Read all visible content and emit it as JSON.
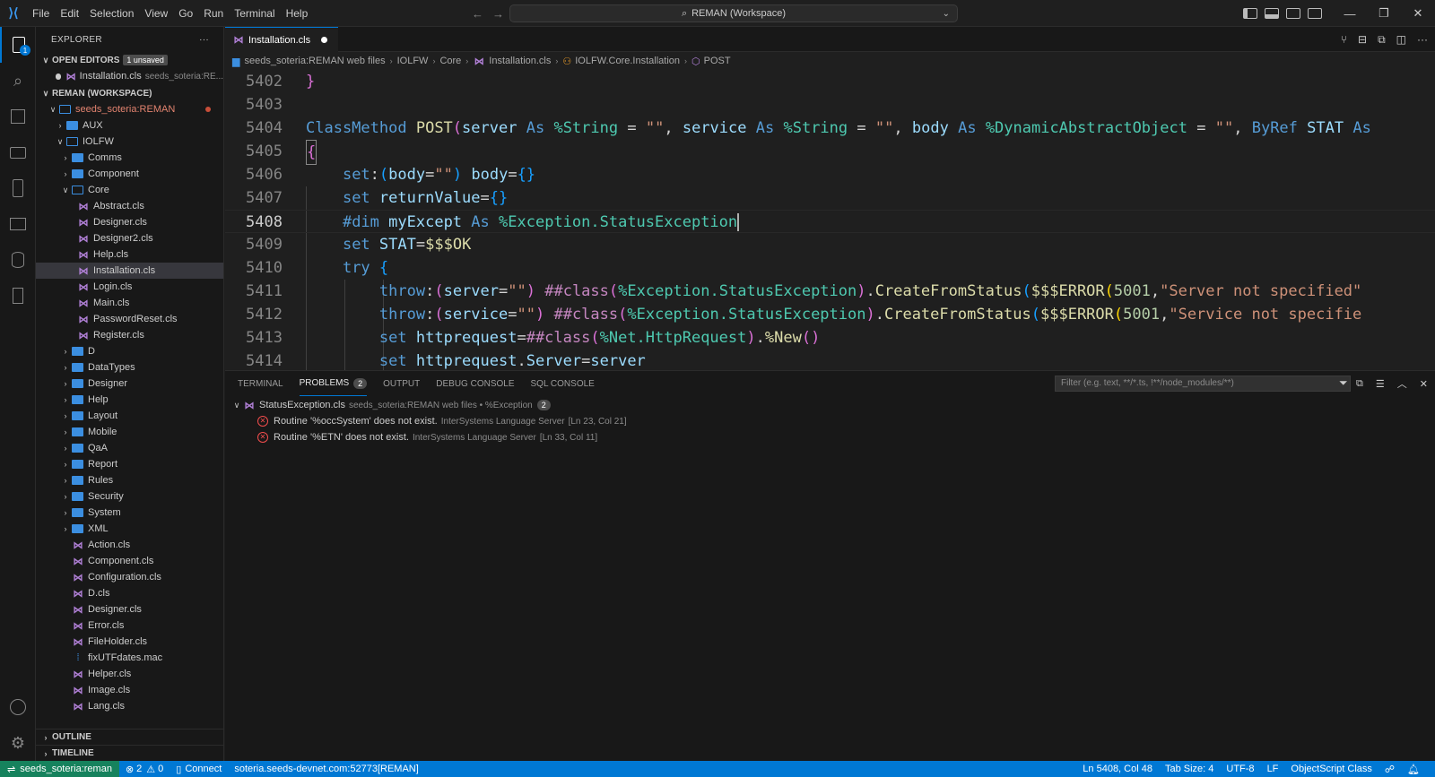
{
  "titlebar": {
    "menu": [
      "File",
      "Edit",
      "Selection",
      "View",
      "Go",
      "Run",
      "Terminal",
      "Help"
    ],
    "command_center": "REMAN (Workspace)"
  },
  "activity": {
    "explorer_badge": "1"
  },
  "sidebar": {
    "title": "EXPLORER",
    "more": "···",
    "open_editors": {
      "label": "OPEN EDITORS",
      "badge": "1 unsaved",
      "items": [
        {
          "name": "Installation.cls",
          "path": "seeds_soteria:RE..."
        }
      ]
    },
    "workspace": {
      "label": "REMAN (WORKSPACE)",
      "root": "seeds_soteria:REMAN",
      "aux": "AUX",
      "iolfw": "IOLFW",
      "iolfw_folders_before": [
        "Comms",
        "Component"
      ],
      "core": "Core",
      "core_files": [
        "Abstract.cls",
        "Designer.cls",
        "Designer2.cls",
        "Help.cls",
        "Installation.cls",
        "Login.cls",
        "Main.cls",
        "PasswordReset.cls",
        "Register.cls"
      ],
      "iolfw_folders_after": [
        "D",
        "DataTypes",
        "Designer",
        "Help",
        "Layout",
        "Mobile",
        "QaA",
        "Report",
        "Rules",
        "Security",
        "System",
        "XML"
      ],
      "iolfw_files": [
        "Action.cls",
        "Component.cls",
        "Configuration.cls",
        "D.cls",
        "Designer.cls",
        "Error.cls",
        "FileHolder.cls",
        "fixUTFdates.mac",
        "Helper.cls",
        "Image.cls",
        "Lang.cls"
      ]
    },
    "outline": "OUTLINE",
    "timeline": "TIMELINE"
  },
  "editor": {
    "tab": "Installation.cls",
    "breadcrumb": [
      "seeds_soteria:REMAN web files",
      "IOLFW",
      "Core",
      "Installation.cls",
      "IOLFW.Core.Installation",
      "POST"
    ],
    "lines": [
      {
        "num": "5402",
        "text": "}"
      },
      {
        "num": "5403",
        "text": ""
      },
      {
        "num": "5404",
        "text": "ClassMethod POST(server As %String = \"\", service As %String = \"\", body As %DynamicAbstractObject = \"\", ByRef STAT As"
      },
      {
        "num": "5405",
        "text": "{"
      },
      {
        "num": "5406",
        "text": "    set:(body=\"\") body={}"
      },
      {
        "num": "5407",
        "text": "    set returnValue={}"
      },
      {
        "num": "5408",
        "text": "    #dim myExcept As %Exception.StatusException"
      },
      {
        "num": "5409",
        "text": "    set STAT=$$$OK"
      },
      {
        "num": "5410",
        "text": "    try {"
      },
      {
        "num": "5411",
        "text": "        throw:(server=\"\") ##class(%Exception.StatusException).CreateFromStatus($$$ERROR(5001,\"Server not specified\""
      },
      {
        "num": "5412",
        "text": "        throw:(service=\"\") ##class(%Exception.StatusException).CreateFromStatus($$$ERROR(5001,\"Service not specifie"
      },
      {
        "num": "5413",
        "text": "        set httprequest=##class(%Net.HttpRequest).%New()"
      },
      {
        "num": "5414",
        "text": "        set httprequest.Server=server"
      }
    ]
  },
  "panel": {
    "tabs": [
      "TERMINAL",
      "PROBLEMS",
      "OUTPUT",
      "DEBUG CONSOLE",
      "SQL CONSOLE"
    ],
    "problems_count": "2",
    "filter_placeholder": "Filter (e.g. text, **/*.ts, !**/node_modules/**)",
    "group": {
      "file": "StatusException.cls",
      "detail": "seeds_soteria:REMAN web files • %Exception",
      "count": "2"
    },
    "problems": [
      {
        "message": "Routine '%occSystem' does not exist.",
        "source": "InterSystems Language Server",
        "location": "[Ln 23, Col 21]"
      },
      {
        "message": "Routine '%ETN' does not exist.",
        "source": "InterSystems Language Server",
        "location": "[Ln 33, Col 11]"
      }
    ]
  },
  "statusbar": {
    "remote": "seeds_soteria:reman",
    "errors": "2",
    "warnings": "0",
    "connect": "Connect",
    "server": "soteria.seeds-devnet.com:52773[REMAN]",
    "cursor": "Ln 5408, Col 48",
    "tab_size": "Tab Size: 4",
    "encoding": "UTF-8",
    "eol": "LF",
    "language": "ObjectScript Class"
  }
}
